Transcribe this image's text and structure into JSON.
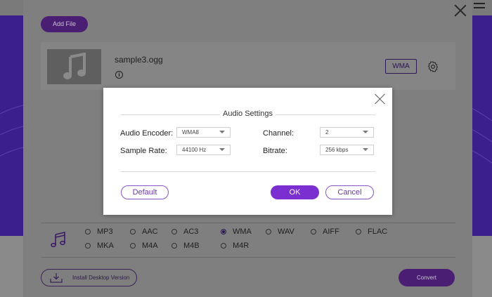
{
  "toolbar": {
    "add_file_label": "Add File"
  },
  "file": {
    "name": "sample3.ogg",
    "format_badge": "WMA",
    "info_icon": "i"
  },
  "formats": {
    "selected": "WMA",
    "row1": [
      "MP3",
      "AAC",
      "AC3",
      "WMA",
      "WAV",
      "AIFF",
      "FLAC"
    ],
    "row2": [
      "MKA",
      "M4A",
      "M4B",
      "M4R"
    ]
  },
  "bottom": {
    "install_label": "Install Desktop Version",
    "convert_label": "Convert"
  },
  "dialog": {
    "title": "Audio Settings",
    "audio_encoder_label": "Audio Encoder:",
    "audio_encoder_value": "WMA8",
    "sample_rate_label": "Sample Rate:",
    "sample_rate_value": "44100 Hz",
    "channel_label": "Channel:",
    "channel_value": "2",
    "bitrate_label": "Bitrate:",
    "bitrate_value": "256 kbps",
    "default_label": "Default",
    "ok_label": "OK",
    "cancel_label": "Cancel"
  },
  "colors": {
    "accent": "#7b2fd0",
    "background_purple": "#3b1f8a"
  }
}
